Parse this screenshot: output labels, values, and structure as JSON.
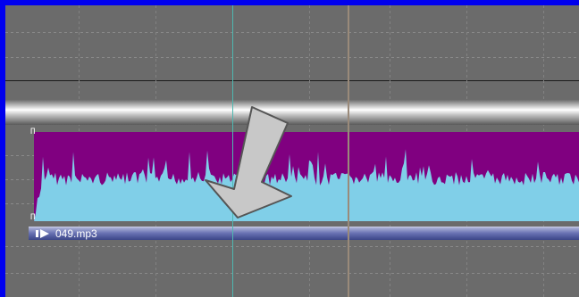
{
  "timeline": {
    "clip": {
      "name": "049.mp3",
      "handle_top": "Π",
      "handle_bottom": "Π"
    }
  },
  "colors": {
    "frame_border": "#0000ee",
    "background": "#6b6b6b",
    "clip_fill": "#800080",
    "waveform": "#80cfe8",
    "clip_bar": "#5560a8",
    "playhead": "#4fb8b0",
    "arrow_fill": "#c8c8c8"
  },
  "icons": {
    "clip_play": "play-icon",
    "annotation": "down-arrow-icon"
  }
}
